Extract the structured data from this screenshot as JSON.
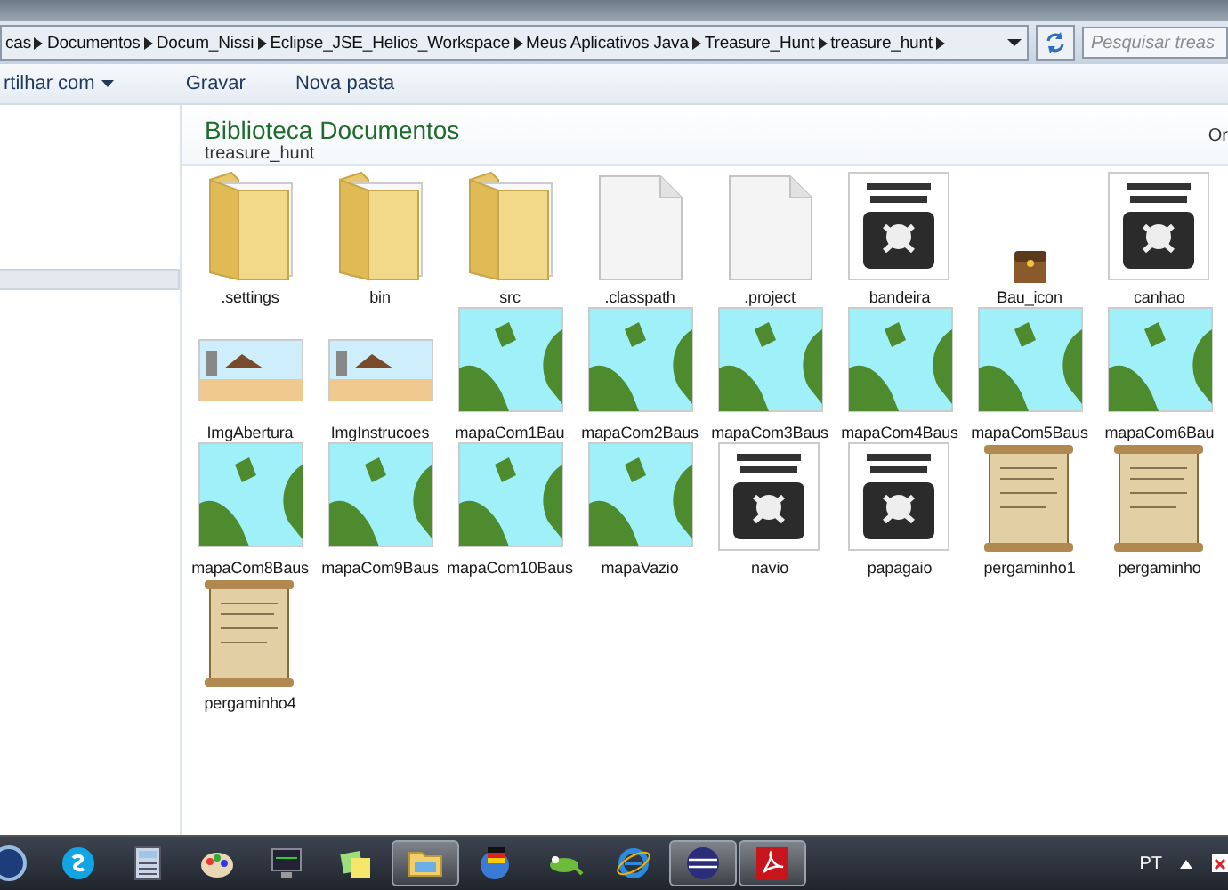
{
  "address_bar": {
    "crumbs": [
      "cas",
      "Documentos",
      "Docum_Nissi",
      "Eclipse_JSE_Helios_Workspace",
      "Meus Aplicativos Java",
      "Treasure_Hunt",
      "treasure_hunt"
    ],
    "search": {
      "placeholder": "Pesquisar treas"
    }
  },
  "toolbar": {
    "items": [
      {
        "label": "rtilhar com",
        "dropdown": true
      },
      {
        "label": "Gravar",
        "dropdown": false
      },
      {
        "label": "Nova pasta",
        "dropdown": false
      }
    ]
  },
  "library": {
    "title": "Biblioteca Documentos",
    "subtitle": "treasure_hunt",
    "arrange_label": "Or"
  },
  "files": [
    {
      "name": ".settings",
      "kind": "folder"
    },
    {
      "name": "bin",
      "kind": "folder"
    },
    {
      "name": "src",
      "kind": "folder"
    },
    {
      "name": ".classpath",
      "kind": "document"
    },
    {
      "name": ".project",
      "kind": "document"
    },
    {
      "name": "bandeira",
      "kind": "poster"
    },
    {
      "name": "Bau_icon",
      "kind": "chest"
    },
    {
      "name": "canhao",
      "kind": "poster"
    },
    {
      "name": "ImgAbertura",
      "kind": "scene"
    },
    {
      "name": "ImgInstrucoes",
      "kind": "scene"
    },
    {
      "name": "mapaCom1Bau",
      "kind": "map"
    },
    {
      "name": "mapaCom2Baus",
      "kind": "map"
    },
    {
      "name": "mapaCom3Baus",
      "kind": "map"
    },
    {
      "name": "mapaCom4Baus",
      "kind": "map"
    },
    {
      "name": "mapaCom5Baus",
      "kind": "map"
    },
    {
      "name": "mapaCom6Bau",
      "kind": "map"
    },
    {
      "name": "mapaCom8Baus",
      "kind": "map"
    },
    {
      "name": "mapaCom9Baus",
      "kind": "map"
    },
    {
      "name": "mapaCom10Baus",
      "kind": "map"
    },
    {
      "name": "mapaVazio",
      "kind": "map"
    },
    {
      "name": "navio",
      "kind": "poster"
    },
    {
      "name": "papagaio",
      "kind": "poster"
    },
    {
      "name": "pergaminho1",
      "kind": "scroll"
    },
    {
      "name": "pergaminho",
      "kind": "scroll"
    },
    {
      "name": "pergaminho4",
      "kind": "scroll"
    }
  ],
  "taskbar": {
    "apps": [
      {
        "kind": "media",
        "selected": false
      },
      {
        "kind": "chat",
        "selected": false
      },
      {
        "kind": "calculator",
        "selected": false
      },
      {
        "kind": "paint",
        "selected": false
      },
      {
        "kind": "monitor",
        "selected": false
      },
      {
        "kind": "notes",
        "selected": false
      },
      {
        "kind": "explorer",
        "selected": true
      },
      {
        "kind": "globe",
        "selected": false
      },
      {
        "kind": "lizard",
        "selected": false
      },
      {
        "kind": "browser",
        "selected": false
      },
      {
        "kind": "eclipse",
        "selected": true
      },
      {
        "kind": "pdf",
        "selected": true
      }
    ],
    "language": "PT"
  }
}
